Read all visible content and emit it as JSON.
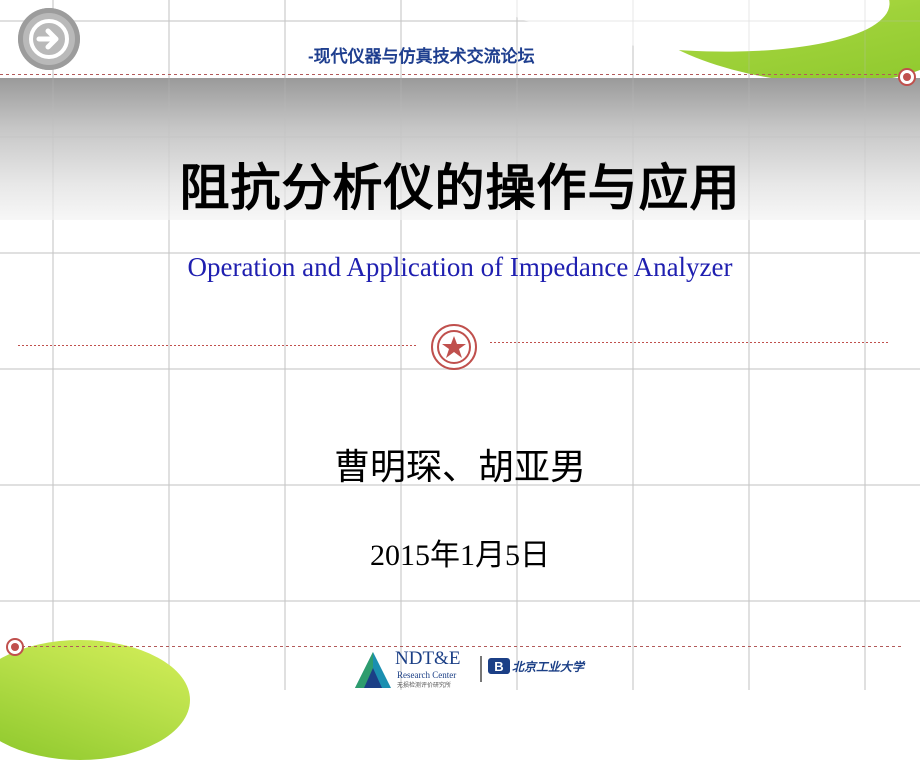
{
  "header": {
    "forum_name": "-现代仪器与仿真技术交流论坛"
  },
  "slide": {
    "title": "阻抗分析仪的操作与应用",
    "subtitle": "Operation and Application of Impedance Analyzer",
    "authors": "曹明琛、胡亚男",
    "date": "2015年1月5日"
  },
  "footer": {
    "logo_title": "NDT&E",
    "logo_subtitle": "Research Center",
    "logo_cn": "无损检测评价研究所",
    "university_logo_text": "北京工业大学"
  },
  "colors": {
    "accent_red": "#c0504d",
    "subtitle_blue": "#1f1fb0",
    "header_blue": "#1f3f8f",
    "swoosh_green": "#9fd23a"
  },
  "icons": {
    "nav": "arrow-right-circle-icon",
    "divider_center": "star-icon",
    "line_end": "target-circle-icon"
  }
}
